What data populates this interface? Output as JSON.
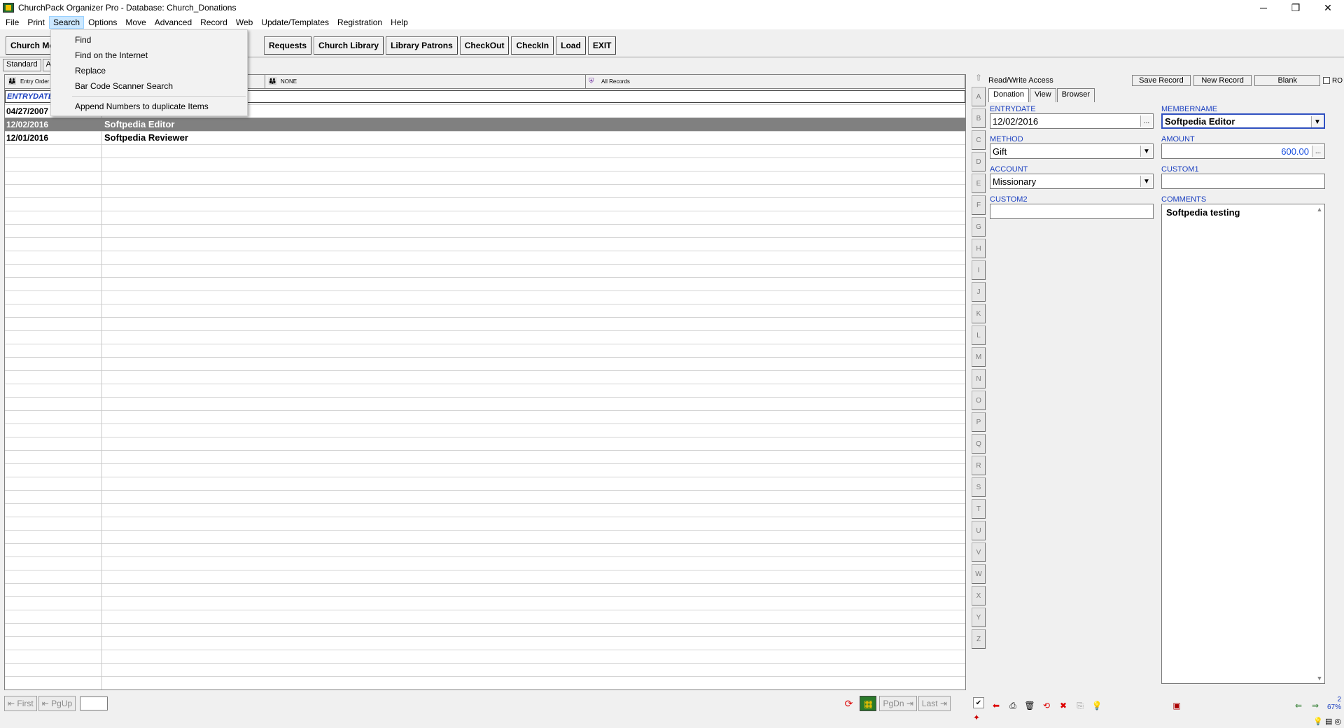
{
  "window": {
    "title": "ChurchPack Organizer Pro - Database: Church_Donations",
    "minimize": "─",
    "restore": "❐",
    "close": "✕"
  },
  "menu": [
    "File",
    "Print",
    "Search",
    "Options",
    "Move",
    "Advanced",
    "Record",
    "Web",
    "Update/Templates",
    "Registration",
    "Help"
  ],
  "search_menu": {
    "items": [
      "Find",
      "Find on the Internet",
      "Replace",
      "Bar Code Scanner Search"
    ],
    "extra_item": "Append Numbers to duplicate Items"
  },
  "toolbar": {
    "buttons": [
      "Church Me",
      "Requests",
      "Church Library",
      "Library Patrons",
      "CheckOut",
      "CheckIn",
      "Load",
      "EXIT"
    ]
  },
  "subtabs": [
    "Standard",
    "A"
  ],
  "sortbar": {
    "sort1": "Entry Order",
    "sort2": "NONE",
    "sort3": "All Records"
  },
  "grid": {
    "header_col1": "ENTRYDATE",
    "rows": [
      {
        "date": "04/27/2007",
        "name": ""
      },
      {
        "date": "12/02/2016",
        "name": "Softpedia Editor"
      },
      {
        "date": "12/01/2016",
        "name": "Softpedia Reviewer"
      }
    ],
    "selected_index": 1
  },
  "alphabet": [
    "A",
    "B",
    "C",
    "D",
    "E",
    "F",
    "G",
    "H",
    "I",
    "J",
    "K",
    "L",
    "M",
    "N",
    "O",
    "P",
    "Q",
    "R",
    "S",
    "T",
    "U",
    "V",
    "W",
    "X",
    "Y",
    "Z"
  ],
  "form": {
    "access": "Read/Write Access",
    "buttons": {
      "save": "Save Record",
      "new": "New Record",
      "blank": "Blank"
    },
    "ro_label": "RO",
    "tabs": [
      "Donation",
      "View",
      "Browser"
    ],
    "fields": {
      "entrydate": {
        "label": "ENTRYDATE",
        "value": "12/02/2016"
      },
      "membername": {
        "label": "MEMBERNAME",
        "value": "Softpedia Editor"
      },
      "method": {
        "label": "METHOD",
        "value": "Gift"
      },
      "amount": {
        "label": "AMOUNT",
        "value": "600.00"
      },
      "account": {
        "label": "ACCOUNT",
        "value": "Missionary"
      },
      "custom1": {
        "label": "CUSTOM1",
        "value": ""
      },
      "custom2": {
        "label": "CUSTOM2",
        "value": ""
      },
      "comments": {
        "label": "COMMENTS",
        "value": "Softpedia testing"
      }
    },
    "ellipsis": "...",
    "dropdown_arrow": "▼"
  },
  "nav": {
    "first": "First",
    "pgup": "PgUp",
    "pgdn": "PgDn",
    "last": "Last"
  },
  "zoom": {
    "line1": "2",
    "line2": "67%"
  },
  "colors": {
    "label_blue": "#1a3fc0",
    "amount_blue": "#1a50e0",
    "selected_row": "#808080"
  }
}
